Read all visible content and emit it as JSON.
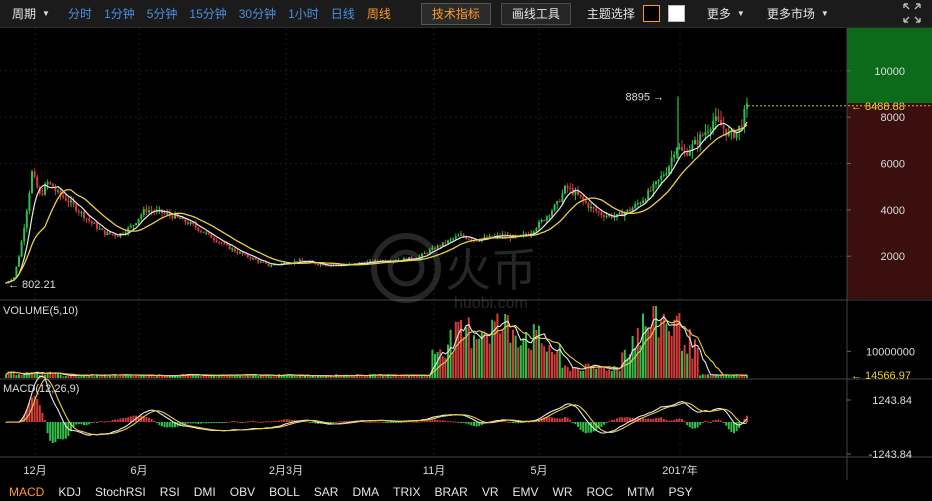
{
  "toolbar": {
    "period_label": "周期",
    "timeframes": [
      {
        "label": "分时",
        "active": false
      },
      {
        "label": "1分钟",
        "active": false
      },
      {
        "label": "5分钟",
        "active": false
      },
      {
        "label": "15分钟",
        "active": false
      },
      {
        "label": "30分钟",
        "active": false
      },
      {
        "label": "1小时",
        "active": false
      },
      {
        "label": "日线",
        "active": false
      },
      {
        "label": "周线",
        "active": true
      }
    ],
    "indicators_btn": "技术指标",
    "drawing_btn": "画线工具",
    "theme_label": "主题选择",
    "more_label": "更多",
    "more_markets_label": "更多市场"
  },
  "colors": {
    "up": "#2fbf4a",
    "down": "#d23c3c",
    "accent": "#ff9a2e",
    "link": "#4a8fe0",
    "ma_white": "#e8e8e8",
    "ma_yellow": "#e8cf45"
  },
  "watermark": {
    "logo_text": "火币",
    "site": "huobi.com"
  },
  "chart_data": [
    {
      "type": "candlestick",
      "title": "",
      "x_labels": [
        "12月",
        "6月",
        "2月3月",
        "11月",
        "5月",
        "2017年"
      ],
      "y_ticks": [
        2000,
        4000,
        6000,
        8000,
        10000
      ],
      "ylim": [
        500,
        11500
      ],
      "annotations": {
        "high": "8895",
        "low": "802.21",
        "last": "8488.88"
      },
      "grid": true
    },
    {
      "type": "bar",
      "title": "VOLUME(5,10)",
      "y_ticks": [
        "10000000"
      ],
      "last_value": "14566.97"
    },
    {
      "type": "bar",
      "title": "MACD(12,26,9)",
      "y_ticks": [
        "1243.84",
        "-1243.84"
      ]
    }
  ],
  "indicator_tabs": [
    {
      "label": "MACD",
      "active": true
    },
    {
      "label": "KDJ",
      "active": false
    },
    {
      "label": "StochRSI",
      "active": false
    },
    {
      "label": "RSI",
      "active": false
    },
    {
      "label": "DMI",
      "active": false
    },
    {
      "label": "OBV",
      "active": false
    },
    {
      "label": "BOLL",
      "active": false
    },
    {
      "label": "SAR",
      "active": false
    },
    {
      "label": "DMA",
      "active": false
    },
    {
      "label": "TRIX",
      "active": false
    },
    {
      "label": "BRAR",
      "active": false
    },
    {
      "label": "VR",
      "active": false
    },
    {
      "label": "EMV",
      "active": false
    },
    {
      "label": "WR",
      "active": false
    },
    {
      "label": "ROC",
      "active": false
    },
    {
      "label": "MTM",
      "active": false
    },
    {
      "label": "PSY",
      "active": false
    }
  ]
}
